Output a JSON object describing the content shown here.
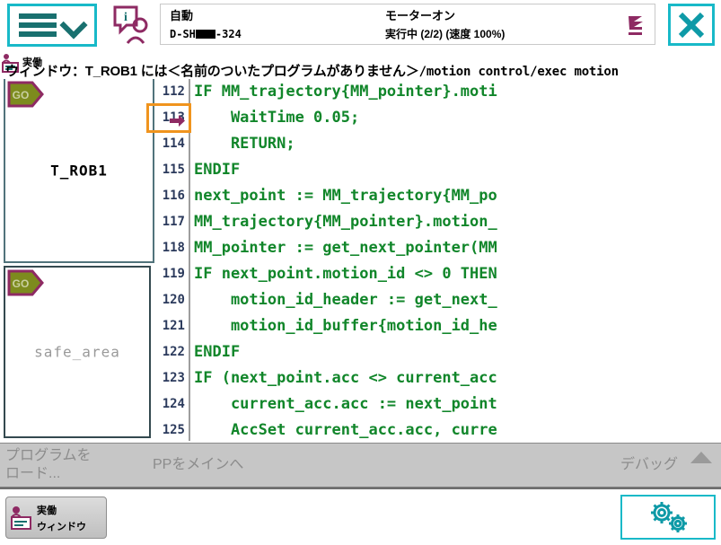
{
  "header": {
    "menu_label": "menu",
    "status_left_line1": "自動",
    "status_left_line2_prefix": "D-SH",
    "status_left_line2_suffix": "-324",
    "status_mid_line1": "モーターオン",
    "status_mid_line2": "実行中 (2/2) (速度 100%)",
    "close_label": "X"
  },
  "titlebar": {
    "tab_label_line1": "実働",
    "path_jp": "ウィンドウ：T_ROB1 には＜名前のついたプログラムがありません＞",
    "path_mono": "/motion control/exec motion"
  },
  "tasks": [
    {
      "name": "T_ROB1",
      "badge": "GO",
      "state": "active"
    },
    {
      "name": "safe_area",
      "badge": "GO",
      "state": "inactive"
    }
  ],
  "code": {
    "pointer_line": "113",
    "lines": [
      {
        "no": "112",
        "text": "IF MM_trajectory{MM_pointer}.moti"
      },
      {
        "no": "113",
        "text": "    WaitTime 0.05;"
      },
      {
        "no": "114",
        "text": "    RETURN;"
      },
      {
        "no": "115",
        "text": "ENDIF"
      },
      {
        "no": "116",
        "text": "next_point := MM_trajectory{MM_po"
      },
      {
        "no": "117",
        "text": "MM_trajectory{MM_pointer}.motion_"
      },
      {
        "no": "118",
        "text": "MM_pointer := get_next_pointer(MM"
      },
      {
        "no": "119",
        "text": "IF next_point.motion_id <> 0 THEN"
      },
      {
        "no": "120",
        "text": "    motion_id_header := get_next_"
      },
      {
        "no": "121",
        "text": "    motion_id_buffer{motion_id_he"
      },
      {
        "no": "122",
        "text": "ENDIF"
      },
      {
        "no": "123",
        "text": "IF (next_point.acc <> current_acc"
      },
      {
        "no": "124",
        "text": "    current_acc.acc := next_point"
      },
      {
        "no": "125",
        "text": "    AccSet current_acc.acc, curre"
      }
    ]
  },
  "actionbar": {
    "load_line1": "プログラムを",
    "load_line2": "ロード...",
    "pp_to_main": "PPをメインへ",
    "debug": "デバッグ"
  },
  "taskbar": {
    "button_line1": "実働",
    "button_line2": "ウィンドウ",
    "quickset_label": "quickset"
  },
  "colors": {
    "accent_teal": "#18b9c8",
    "code_green": "#11862a",
    "pointer_orange": "#f0941e",
    "badge_olive": "#7d8b1e",
    "badge_border": "#8e2a63",
    "toolbar_gray": "#c6c6c6"
  }
}
